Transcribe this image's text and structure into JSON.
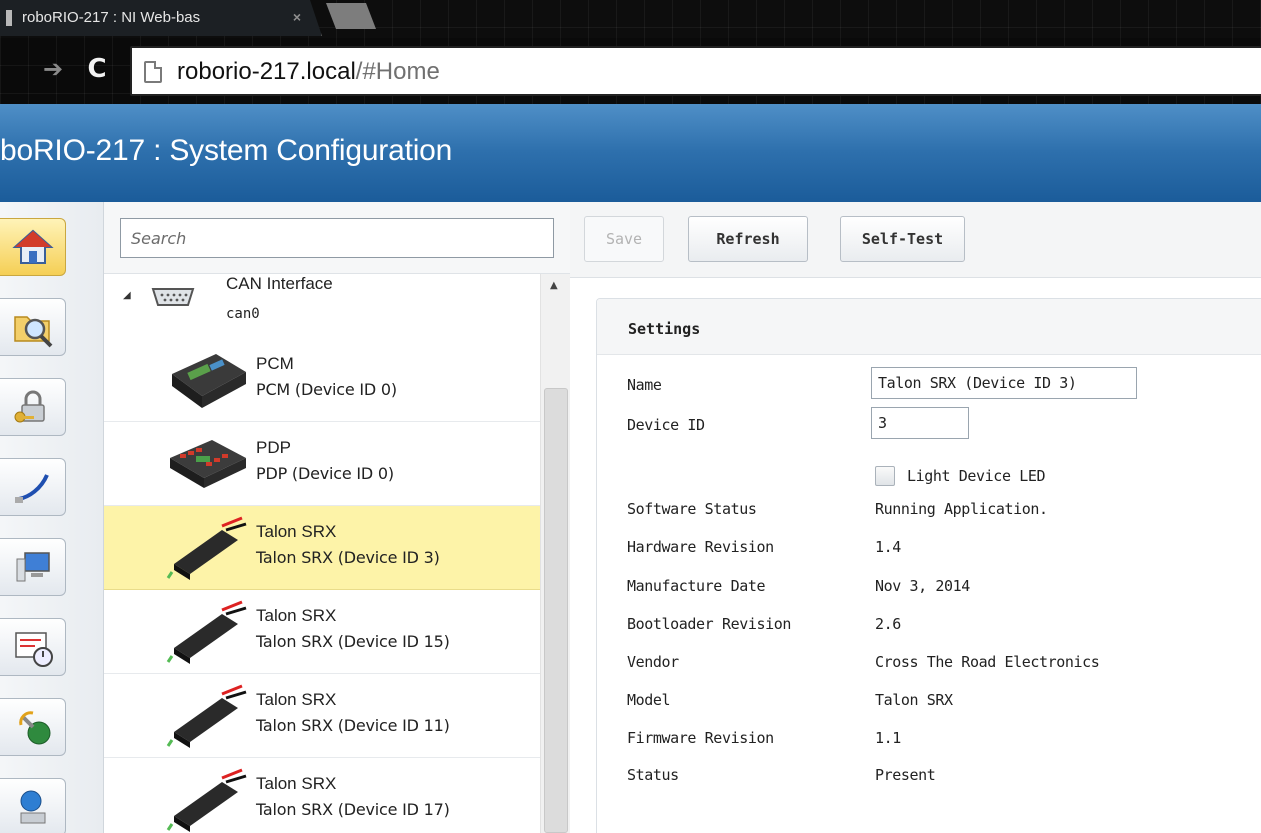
{
  "browser": {
    "tab_title": "roboRIO-217 : NI Web-bas",
    "tab_close": "×",
    "forward_glyph": "➔",
    "reload_glyph": "C",
    "url_host": "roborio-217.local",
    "url_path": "/#Home"
  },
  "header": {
    "title": "boRIO-217 : System Configuration"
  },
  "rail": {
    "items": [
      {
        "icon": "home-icon",
        "active": true
      },
      {
        "icon": "folder-search-icon"
      },
      {
        "icon": "security-lock-icon"
      },
      {
        "icon": "network-cable-icon"
      },
      {
        "icon": "monitor-icon"
      },
      {
        "icon": "schedule-clock-icon"
      },
      {
        "icon": "web-services-globe-icon"
      },
      {
        "icon": "remote-computer-icon"
      }
    ]
  },
  "search": {
    "placeholder": "Search"
  },
  "tree": {
    "can": {
      "toggle": "◢",
      "name": "CAN Interface",
      "sub": "can0"
    },
    "devices": [
      {
        "name": "PCM",
        "sub": "PCM (Device ID 0)",
        "kind": "pcm",
        "selected": false
      },
      {
        "name": "PDP",
        "sub": "PDP (Device ID 0)",
        "kind": "pdp",
        "selected": false
      },
      {
        "name": "Talon SRX",
        "sub": "Talon SRX (Device ID 3)",
        "kind": "talon",
        "selected": true
      },
      {
        "name": "Talon SRX",
        "sub": "Talon SRX (Device ID 15)",
        "kind": "talon",
        "selected": false
      },
      {
        "name": "Talon SRX",
        "sub": "Talon SRX (Device ID 11)",
        "kind": "talon",
        "selected": false
      },
      {
        "name": "Talon SRX",
        "sub": "Talon SRX (Device ID 17)",
        "kind": "talon",
        "selected": false
      }
    ],
    "scroll_up": "▲"
  },
  "toolbar": {
    "save_label": "Save",
    "refresh_label": "Refresh",
    "selftest_label": "Self-Test"
  },
  "settings": {
    "heading": "Settings",
    "name_label": "Name",
    "name_value": "Talon SRX (Device ID 3)",
    "device_id_label": "Device ID",
    "device_id_value": "3",
    "light_led_label": "Light Device LED",
    "fields": [
      {
        "label": "Software Status",
        "value": "Running Application."
      },
      {
        "label": "Hardware Revision",
        "value": "1.4"
      },
      {
        "label": "Manufacture Date",
        "value": "Nov 3, 2014"
      },
      {
        "label": "Bootloader Revision",
        "value": "2.6"
      },
      {
        "label": "Vendor",
        "value": "Cross The Road Electronics"
      },
      {
        "label": "Model",
        "value": "Talon SRX"
      },
      {
        "label": "Firmware Revision",
        "value": "1.1"
      },
      {
        "label": "Status",
        "value": "Present"
      }
    ]
  },
  "colors": {
    "header_blue": "#2e70ad",
    "selected_row": "#fdf3a8",
    "active_rail": "#f5cf55"
  }
}
